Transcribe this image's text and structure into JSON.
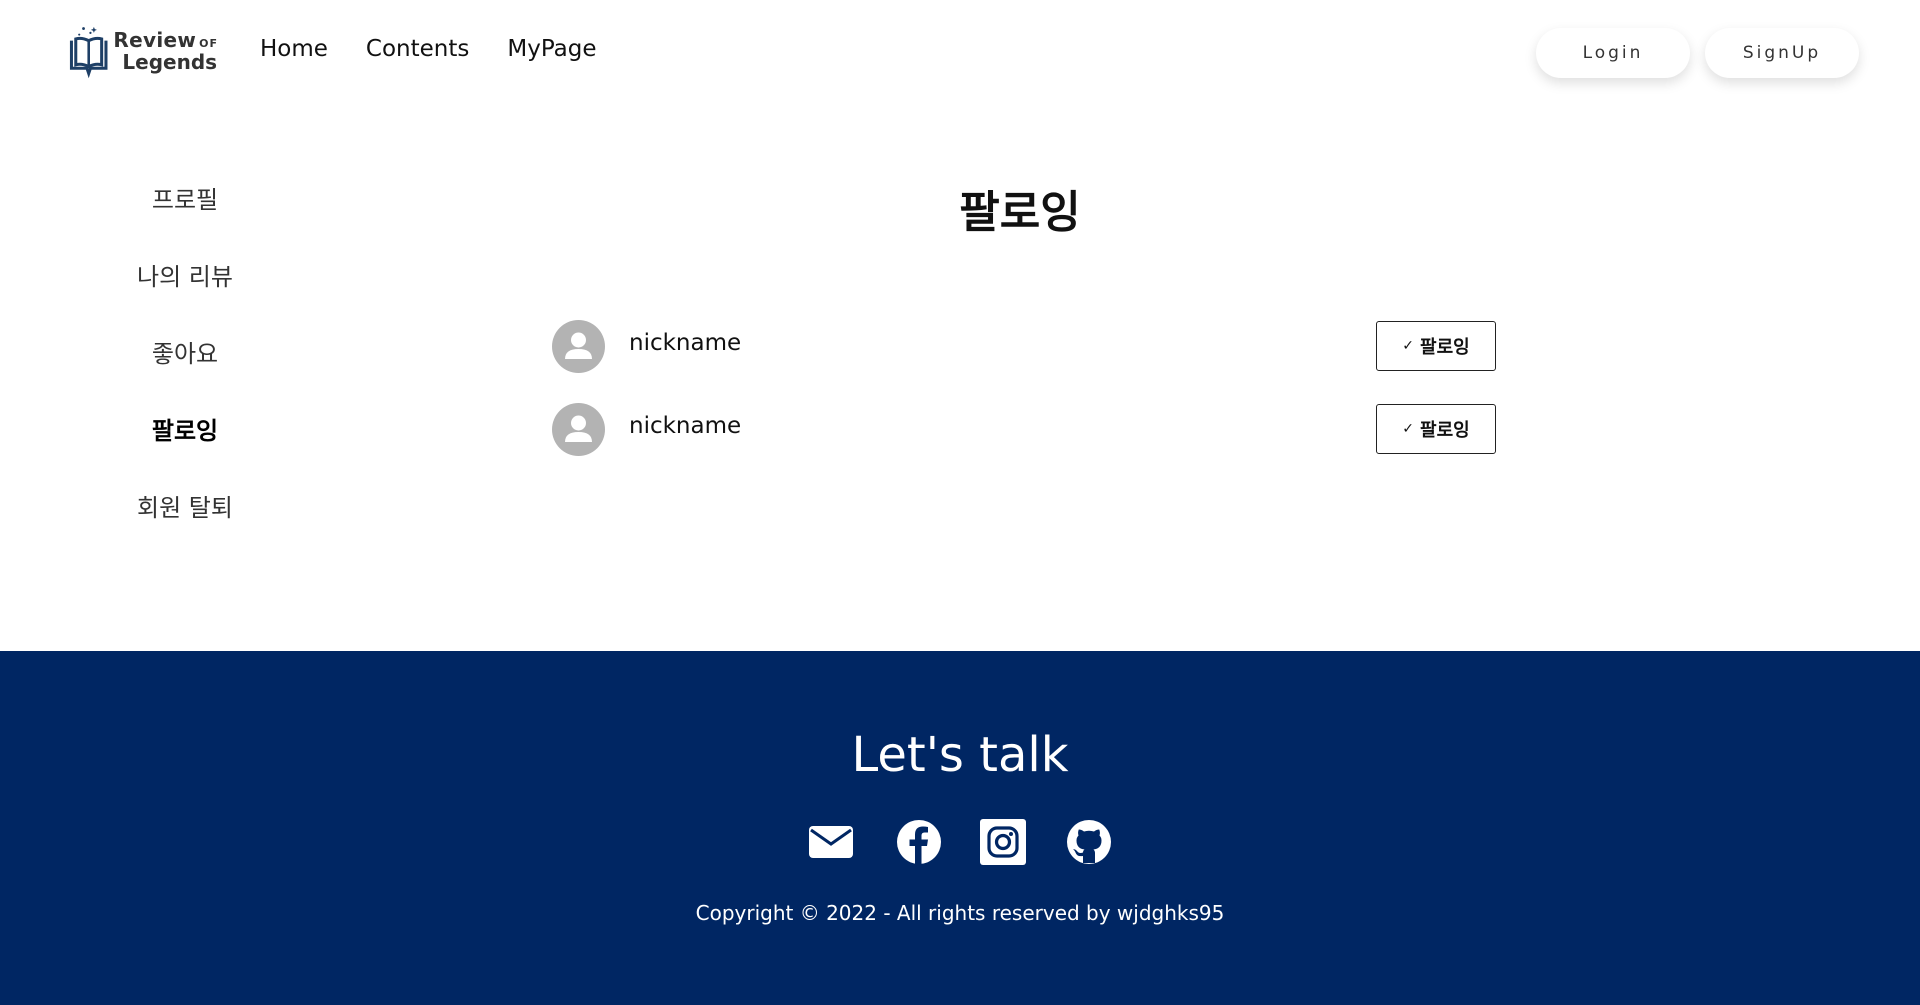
{
  "brand": {
    "line1": "Review",
    "line1_small": "OF",
    "line2": "Legends",
    "color": "#1e3f66"
  },
  "nav": {
    "items": [
      "Home",
      "Contents",
      "MyPage"
    ]
  },
  "auth": {
    "login_label": "Login",
    "signup_label": "SignUp"
  },
  "sidebar": {
    "items": [
      {
        "label": "프로필"
      },
      {
        "label": "나의 리뷰"
      },
      {
        "label": "좋아요"
      },
      {
        "label": "팔로잉",
        "active": true
      },
      {
        "label": "회원 탈퇴"
      }
    ]
  },
  "main": {
    "title": "팔로잉",
    "following": [
      {
        "nickname": "nickname",
        "button_label": "팔로잉",
        "button_icon": "check-icon"
      },
      {
        "nickname": "nickname",
        "button_label": "팔로잉",
        "button_icon": "check-icon"
      }
    ]
  },
  "footer": {
    "title": "Let's talk",
    "socials": [
      "mail-icon",
      "facebook-icon",
      "instagram-icon",
      "github-icon"
    ],
    "copyright": "Copyright © 2022 - All rights reserved by wjdghks95",
    "background": "#002663"
  }
}
